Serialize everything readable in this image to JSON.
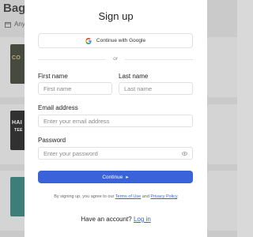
{
  "background": {
    "title": "Bag&",
    "filter_label": "Any",
    "thumb1_text": "CO",
    "thumb2_text": "HAI",
    "thumb2_sub": "TEE"
  },
  "modal": {
    "title": "Sign up",
    "google_button": "Continue with Google",
    "divider_text": "or",
    "first_name": {
      "label": "First name",
      "placeholder": "First name"
    },
    "last_name": {
      "label": "Last name",
      "placeholder": "Last name"
    },
    "email": {
      "label": "Email address",
      "placeholder": "Enter your email address"
    },
    "password": {
      "label": "Password",
      "placeholder": "Enter your password"
    },
    "continue_button": "Continue",
    "continue_arrow": "▸",
    "terms": {
      "prefix": "By signing up, you agree to our ",
      "terms_link": "Terms of Use",
      "and": " and ",
      "privacy_link": "Privacy Policy",
      "suffix": "."
    },
    "have_account": "Have an account?",
    "login_link": "Log in"
  },
  "colors": {
    "accent": "#3b63d9",
    "overlay": "#d9d9d9"
  }
}
